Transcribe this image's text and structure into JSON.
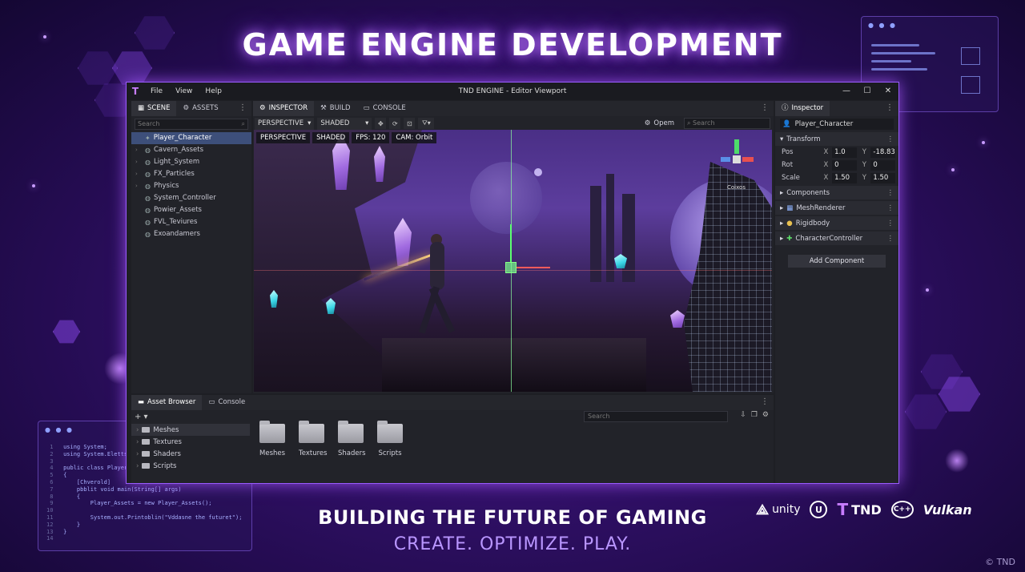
{
  "headline": "GAME ENGINE DEVELOPMENT",
  "tagline": "BUILDING THE FUTURE OF GAMING",
  "subtag": "CREATE. OPTIMIZE. PLAY.",
  "copyright": "© TND",
  "logos": [
    "unity",
    "TND",
    "C++",
    "Vulkan"
  ],
  "code_card": {
    "lines": [
      "using System;",
      "using System.Eletts",
      "",
      "public class Player",
      "{",
      "    [Chverold]",
      "    pbblit void main(String[] args)",
      "    {",
      "        Player_Assets = new Player_Assets();",
      "",
      "        System.out.Printoblin(\"Vddasne the futuret\");",
      "    }",
      "}",
      ""
    ]
  },
  "window": {
    "title": "TND ENGINE - Editor Viewport",
    "menu": [
      "File",
      "View",
      "Help"
    ],
    "controls": [
      "—",
      "☐",
      "✕"
    ]
  },
  "scene_panel": {
    "tabs": [
      "SCENE",
      "ASSETS"
    ],
    "search_placeholder": "Search",
    "items": [
      {
        "label": "Player_Character",
        "selected": true
      },
      {
        "label": "Cavern_Assets"
      },
      {
        "label": "Light_System"
      },
      {
        "label": "FX_Particles"
      },
      {
        "label": "Physics"
      },
      {
        "label": "System_Controller"
      },
      {
        "label": "Powier_Assets"
      },
      {
        "label": "FVL_Teviures"
      },
      {
        "label": "Exoandamers"
      }
    ]
  },
  "center_panel": {
    "tabs": [
      "INSPECTOR",
      "BUILD",
      "CONSOLE"
    ],
    "projection": "PERSPECTIVE",
    "shading": "SHADED",
    "open_label": "Opem",
    "search_placeholder": "Search",
    "hud": [
      "PERSPECTIVE",
      "SHADED",
      "FPS: 120",
      "CAM: Orbit"
    ],
    "gizmo_label": "Coixos"
  },
  "inspector": {
    "tab": "Inspector",
    "object_name": "Player_Character",
    "transform_label": "Transform",
    "rows": [
      {
        "label": "Pos",
        "x": "1.0",
        "y": "-18.83"
      },
      {
        "label": "Rot",
        "x": "0",
        "y": "0"
      },
      {
        "label": "Scale",
        "x": "1.50",
        "y": "1.50"
      }
    ],
    "components_label": "Components",
    "components": [
      "MeshRenderer",
      "Rigidbody",
      "CharacterController"
    ],
    "add_component": "Add Component"
  },
  "bottom_panel": {
    "tabs": [
      "Asset Browser",
      "Console"
    ],
    "search_placeholder": "Search",
    "folders": [
      "Meshes",
      "Textures",
      "Shaders",
      "Scripts"
    ],
    "tiles": [
      "Meshes",
      "Textures",
      "Shaders",
      "Scripts"
    ]
  },
  "colors": {
    "accent": "#9a5bff",
    "selection": "#3d4f7a",
    "gizmo_x": "#e85050",
    "gizmo_y": "#4ddc6a",
    "gizmo_z": "#5a8fe8"
  }
}
